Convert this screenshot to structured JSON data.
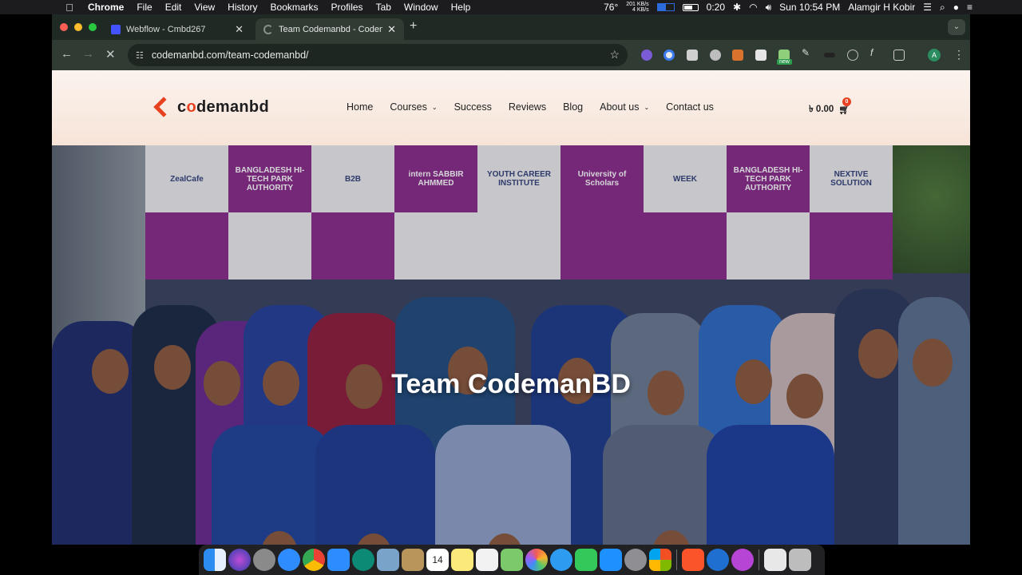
{
  "menubar": {
    "app_name": "Chrome",
    "items": [
      "File",
      "Edit",
      "View",
      "History",
      "Bookmarks",
      "Profiles",
      "Tab",
      "Window",
      "Help"
    ],
    "temperature": "76°",
    "net_up": "201 KB/s",
    "net_down": "4 KB/s",
    "timer": "0:20",
    "clock": "Sun 10:54 PM",
    "user": "Alamgir H Kobir"
  },
  "browser": {
    "tabs": [
      {
        "title": "Webflow - Cmbd267"
      },
      {
        "title": "Team Codemanbd - Codeman"
      }
    ],
    "url": "codemanbd.com/team-codemanbd/",
    "extension_badge": "new",
    "profile_initial": "A"
  },
  "site": {
    "logo_prefix": "c",
    "logo_o": "o",
    "logo_rest": "demanbd",
    "nav": [
      {
        "label": "Home",
        "dropdown": false
      },
      {
        "label": "Courses",
        "dropdown": true
      },
      {
        "label": "Success",
        "dropdown": false
      },
      {
        "label": "Reviews",
        "dropdown": false
      },
      {
        "label": "Blog",
        "dropdown": false
      },
      {
        "label": "About us",
        "dropdown": true
      },
      {
        "label": "Contact us",
        "dropdown": false
      }
    ],
    "cart_total": "৳ 0.00",
    "cart_count": "0",
    "hero_title": "Team CodemanBD",
    "backdrop_panels": [
      "ZealCafe",
      "BANGLADESH HI-TECH PARK AUTHORITY",
      "B2B",
      "intern SABBIR AHMMED",
      "YOUTH CAREER INSTITUTE",
      "University of Scholars",
      "WEEK",
      "BANGLADESH HI-TECH PARK AUTHORITY",
      "NEXTIVE SOLUTION"
    ]
  },
  "colors": {
    "brand_orange": "#e8411f",
    "backdrop_purple": "#8a2c8a",
    "chrome_dark": "#2f3b33"
  },
  "dock": {
    "apps": [
      "finder-icon",
      "siri-icon",
      "launchpad-icon",
      "safari-icon",
      "chrome-icon",
      "zoom-icon",
      "podcast-icon",
      "preview-icon",
      "notes-folder-icon",
      "calendar-icon",
      "notes-icon",
      "reminders-icon",
      "maps-icon",
      "photos-icon",
      "messages-icon",
      "facetime-icon",
      "appstore-icon",
      "settings-icon",
      "office-icon",
      "brave-icon",
      "edge-icon",
      "vpn-icon",
      "files-icon",
      "trash-icon"
    ],
    "calendar_day": "14"
  }
}
